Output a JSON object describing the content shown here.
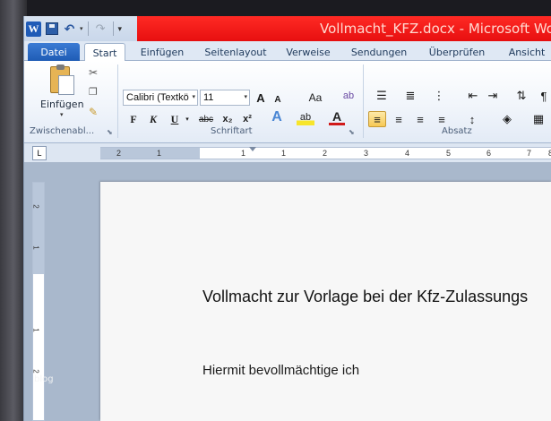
{
  "window": {
    "title": "Vollmacht_KFZ.docx  -  Microsoft Word"
  },
  "quick_access": {
    "word_icon": "W",
    "icons": [
      "word-app-icon",
      "save-icon",
      "undo-icon",
      "redo-icon",
      "customize-qat-icon"
    ]
  },
  "tabs": [
    {
      "label": "Datei"
    },
    {
      "label": "Start"
    },
    {
      "label": "Einfügen"
    },
    {
      "label": "Seitenlayout"
    },
    {
      "label": "Verweise"
    },
    {
      "label": "Sendungen"
    },
    {
      "label": "Überprüfen"
    },
    {
      "label": "Ansicht"
    }
  ],
  "ribbon": {
    "clipboard": {
      "paste_label": "Einfügen",
      "group_label": "Zwischenabl..."
    },
    "font": {
      "font_name": "Calibri (Textkö",
      "font_size": "11",
      "group_label": "Schriftart",
      "bold": "F",
      "italic": "K",
      "underline": "U",
      "strike": "abc",
      "subscript": "x₂",
      "superscript": "x²",
      "grow": "A",
      "shrink": "A",
      "change_case": "Aa"
    },
    "paragraph": {
      "group_label": "Absatz"
    }
  },
  "ruler": {
    "numbers": [
      "2",
      "1",
      "1",
      "1",
      "2",
      "3",
      "4",
      "5",
      "6",
      "7",
      "8"
    ]
  },
  "vertical_ruler": {
    "numbers": [
      "2",
      "1",
      "1",
      "2"
    ]
  },
  "document": {
    "heading": "Vollmacht zur Vorlage bei der Kfz-Zulassungs",
    "line1": "Hiermit bevollmächtige ich",
    "comma": ","
  },
  "watermark": "blog",
  "colors": {
    "title_bar_red": "#e70f10",
    "file_tab_blue": "#1f5cb5",
    "ribbon_bg": "#f1f5fb"
  }
}
